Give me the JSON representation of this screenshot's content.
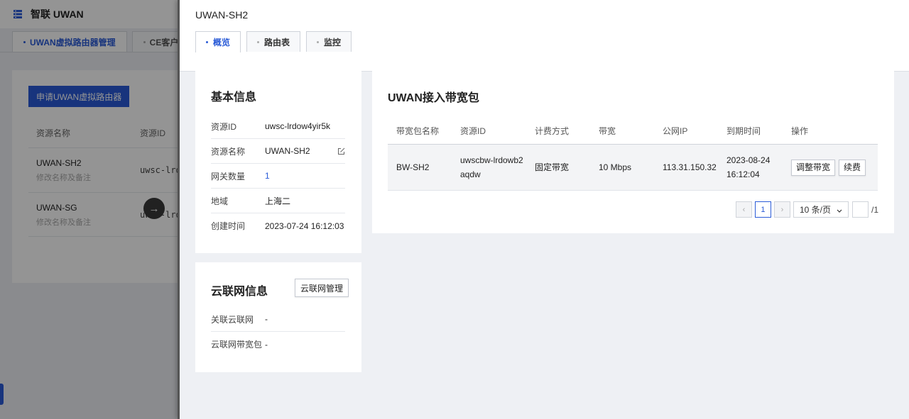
{
  "app": {
    "title": "智联 UWAN"
  },
  "background": {
    "tabs": [
      {
        "label": "UWAN虚拟路由器管理"
      },
      {
        "label": "CE客户"
      }
    ],
    "apply_button": "申请UWAN虚拟路由器",
    "table_headers": [
      "资源名称",
      "资源ID"
    ],
    "rows": [
      {
        "name": "UWAN-SH2",
        "sub": "修改名称及备注",
        "id": "uwsc-lrd"
      },
      {
        "name": "UWAN-SG",
        "sub": "修改名称及备注",
        "id": "uwsc-lrd"
      }
    ]
  },
  "drawer": {
    "title": "UWAN-SH2",
    "tabs": [
      {
        "label": "概览"
      },
      {
        "label": "路由表"
      },
      {
        "label": "监控"
      }
    ]
  },
  "basic_info": {
    "title": "基本信息",
    "rows": [
      {
        "label": "资源ID",
        "value": "uwsc-lrdow4yir5k"
      },
      {
        "label": "资源名称",
        "value": "UWAN-SH2"
      },
      {
        "label": "网关数量",
        "value": "1"
      },
      {
        "label": "地域",
        "value": "上海二"
      },
      {
        "label": "创建时间",
        "value": "2023-07-24 16:12:03"
      }
    ]
  },
  "cloud_net": {
    "title": "云联网信息",
    "manage_button": "云联网管理",
    "rows": [
      {
        "label": "关联云联网",
        "value": "-"
      },
      {
        "label": "云联网带宽包",
        "value": "-"
      }
    ]
  },
  "bandwidth": {
    "title": "UWAN接入带宽包",
    "headers": [
      "带宽包名称",
      "资源ID",
      "计费方式",
      "带宽",
      "公网IP",
      "到期时间",
      "操作"
    ],
    "rows": [
      {
        "name": "BW-SH2",
        "id": "uwscbw-lrdowb2aqdw",
        "billing": "固定带宽",
        "bandwidth": "10 Mbps",
        "ip": "113.31.150.32",
        "expire": "2023-08-24 16:12:04",
        "actions": [
          "调整带宽",
          "续费"
        ]
      }
    ],
    "pager": {
      "current": "1",
      "page_size": "10 条/页",
      "total": "/1"
    }
  },
  "colors": {
    "accent": "#2a5bd7",
    "panel_bg": "#ffffff",
    "drawer_bg": "#eef0f4"
  }
}
